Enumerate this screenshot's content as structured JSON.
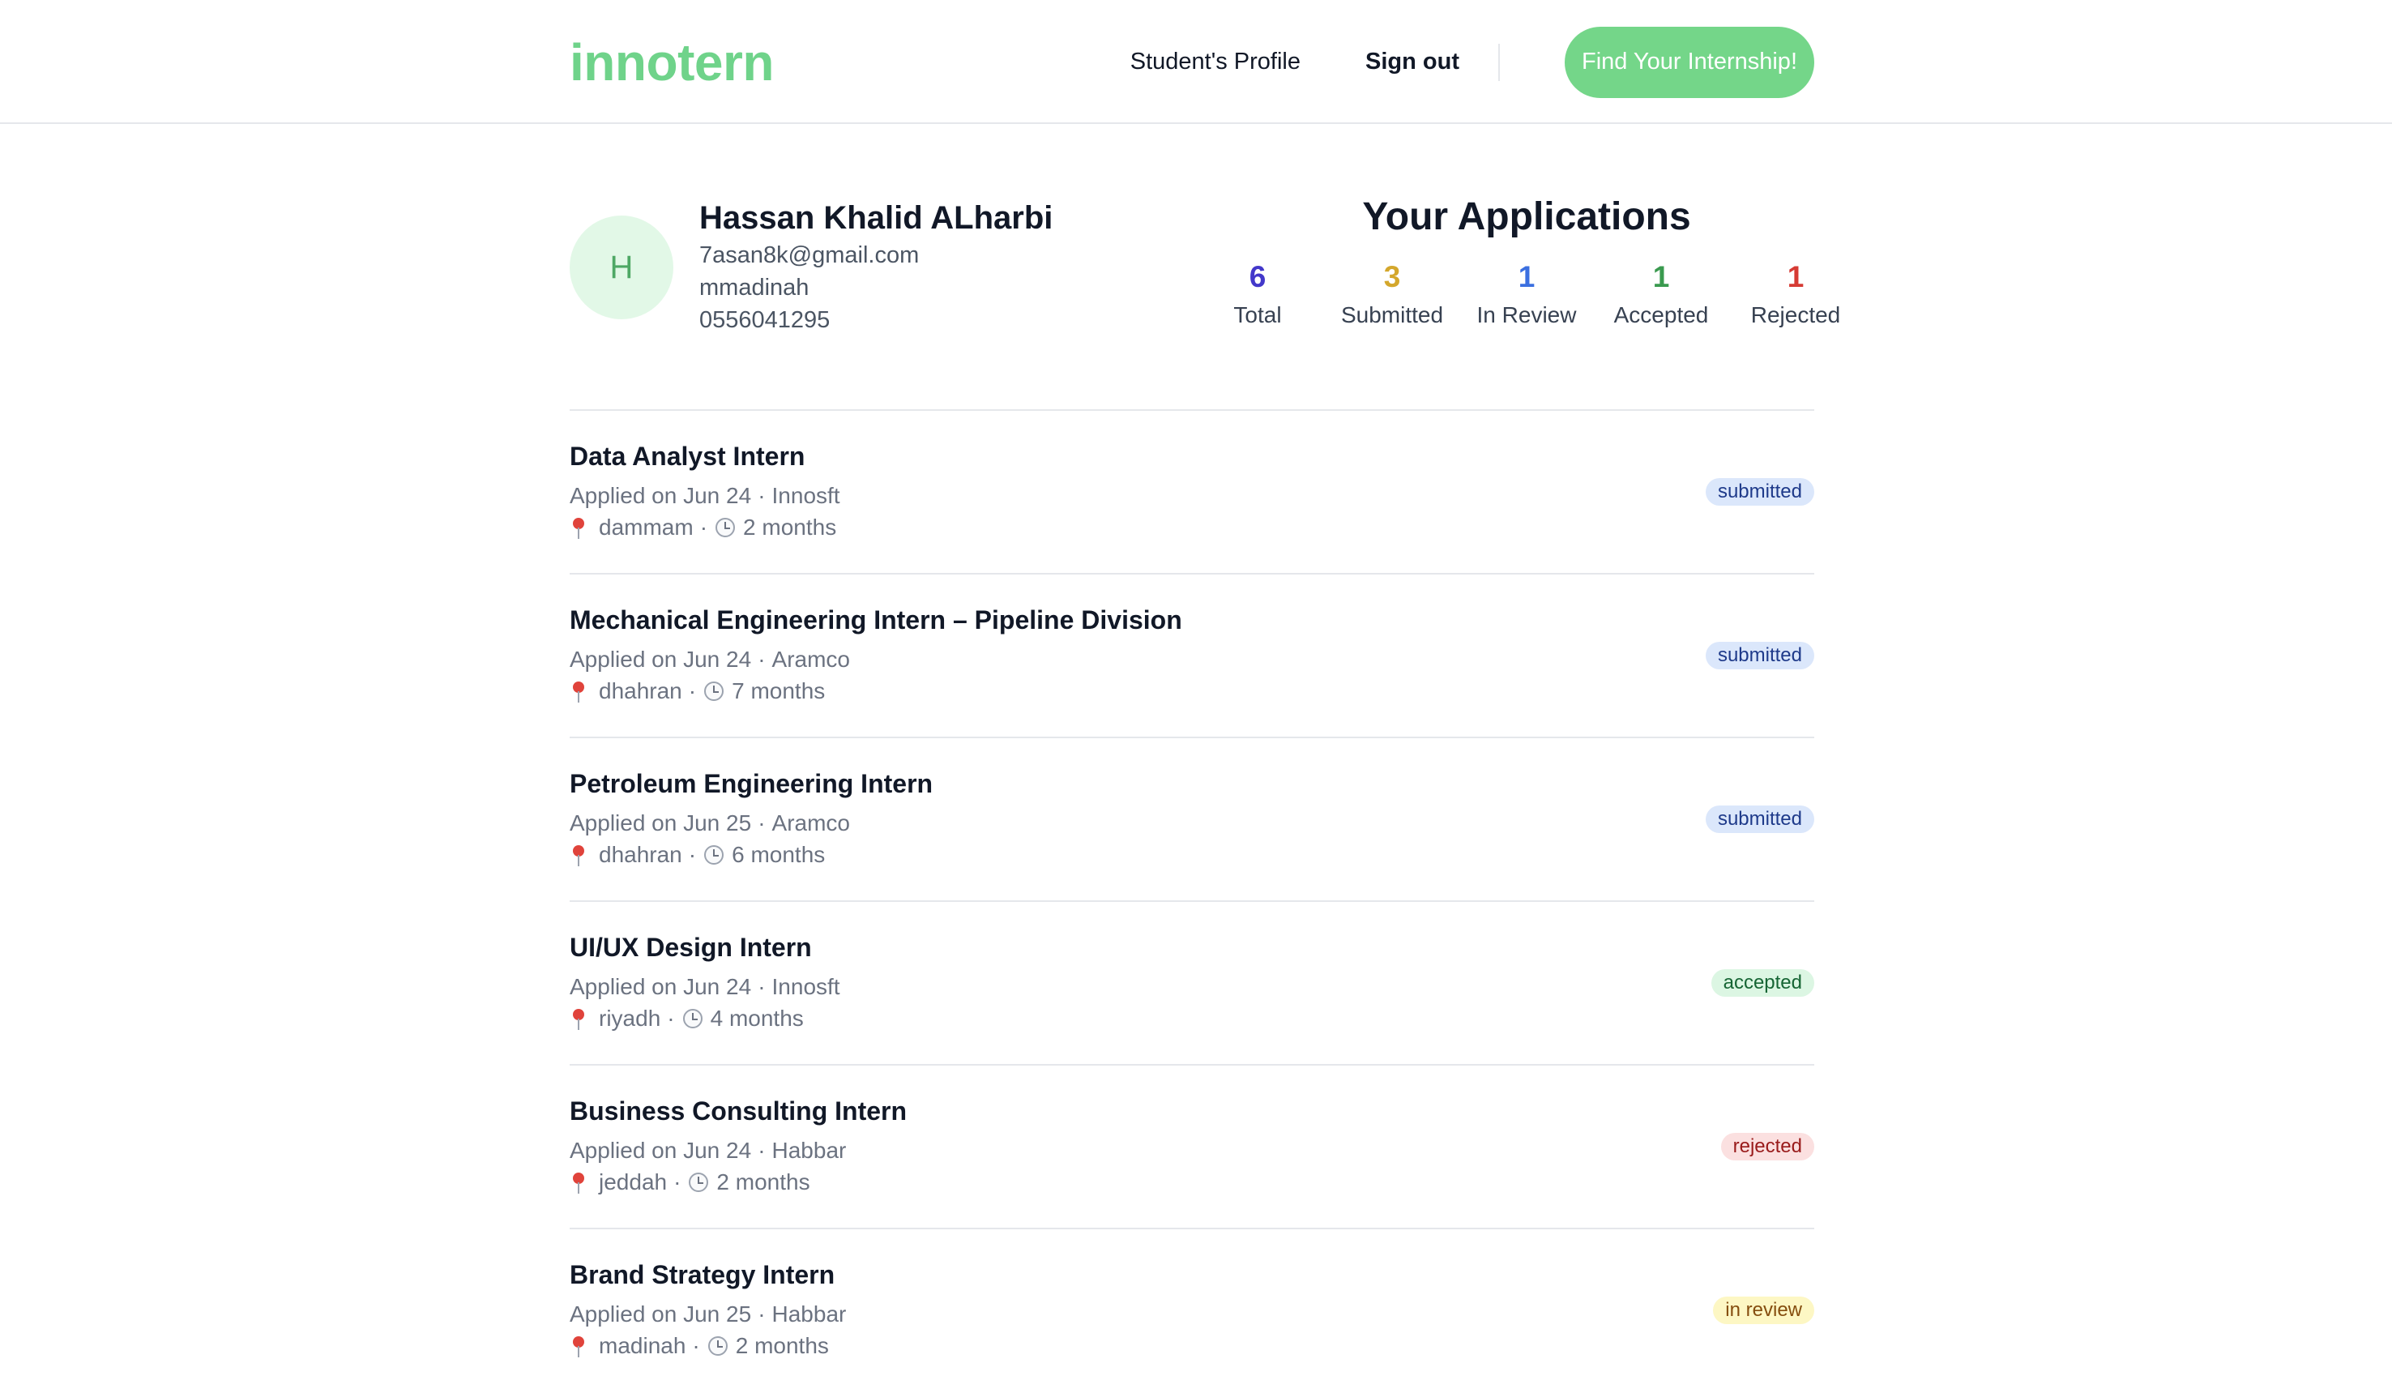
{
  "brand": {
    "logo": "innotern"
  },
  "nav": {
    "profile_label": "Student's Profile",
    "signout_label": "Sign out",
    "cta_label": "Find Your Internship!"
  },
  "profile": {
    "initial": "H",
    "name": "Hassan Khalid ALharbi",
    "email": "7asan8k@gmail.com",
    "city": "mmadinah",
    "phone": "0556041295"
  },
  "summary": {
    "title": "Your Applications",
    "stats": [
      {
        "value": "6",
        "label": "Total",
        "color": "#4338ca"
      },
      {
        "value": "3",
        "label": "Submitted",
        "color": "#d4a72c"
      },
      {
        "value": "1",
        "label": "In Review",
        "color": "#3b6fe0"
      },
      {
        "value": "1",
        "label": "Accepted",
        "color": "#3a9a4f"
      },
      {
        "value": "1",
        "label": "Rejected",
        "color": "#d63b34"
      }
    ]
  },
  "applications": [
    {
      "title": "Data Analyst Intern",
      "applied": "Applied on Jun 24",
      "company": "Innosft",
      "location": "dammam",
      "duration": "2 months",
      "status": "submitted",
      "status_kind": "submitted"
    },
    {
      "title": "Mechanical Engineering Intern – Pipeline Division",
      "applied": "Applied on Jun 24",
      "company": "Aramco",
      "location": "dhahran",
      "duration": "7 months",
      "status": "submitted",
      "status_kind": "submitted"
    },
    {
      "title": "Petroleum Engineering Intern",
      "applied": "Applied on Jun 25",
      "company": "Aramco",
      "location": "dhahran",
      "duration": "6 months",
      "status": "submitted",
      "status_kind": "submitted"
    },
    {
      "title": "UI/UX Design Intern",
      "applied": "Applied on Jun 24",
      "company": "Innosft",
      "location": "riyadh",
      "duration": "4 months",
      "status": "accepted",
      "status_kind": "accepted"
    },
    {
      "title": "Business Consulting Intern",
      "applied": "Applied on Jun 24",
      "company": "Habbar",
      "location": "jeddah",
      "duration": "2 months",
      "status": "rejected",
      "status_kind": "rejected"
    },
    {
      "title": "Brand Strategy Intern",
      "applied": "Applied on Jun 25",
      "company": "Habbar",
      "location": "madinah",
      "duration": "2 months",
      "status": "in review",
      "status_kind": "inreview"
    }
  ],
  "icons": {
    "location": "map-pin-icon",
    "duration": "clock-icon"
  }
}
